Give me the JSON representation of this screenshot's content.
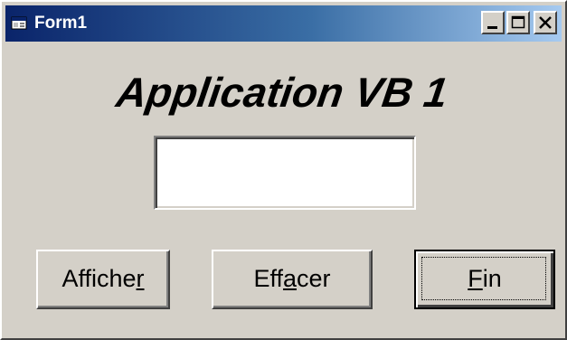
{
  "window": {
    "title": "Form1",
    "icon": "form-window-icon",
    "controls": {
      "minimize_icon": "minimize-icon",
      "maximize_icon": "maximize-icon",
      "close_icon": "close-icon"
    }
  },
  "form": {
    "heading": "Application VB 1",
    "textbox_value": ""
  },
  "buttons": {
    "afficher": {
      "before": "Affiche",
      "access_key": "r",
      "after": ""
    },
    "effacer": {
      "before": "Eff",
      "access_key": "a",
      "after": "cer"
    },
    "fin": {
      "before": "",
      "access_key": "F",
      "after": "in"
    }
  },
  "colors": {
    "face": "#d4d0c8",
    "titlebar_start": "#0a246a",
    "titlebar_end": "#a6caf0"
  }
}
